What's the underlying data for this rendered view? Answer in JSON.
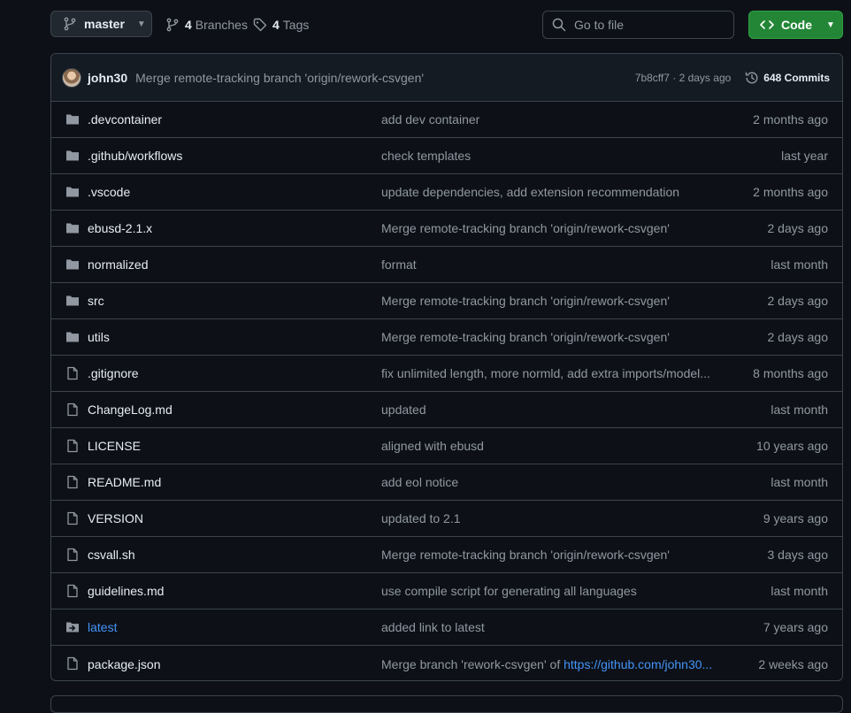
{
  "toolbar": {
    "branch": "master",
    "branches_count": "4",
    "branches_label": "Branches",
    "tags_count": "4",
    "tags_label": "Tags",
    "search_placeholder": "Go to file",
    "code_label": "Code"
  },
  "latest_commit": {
    "author": "john30",
    "message": "Merge remote-tracking branch 'origin/rework-csvgen'",
    "sha_time": "7b8cff7 · 2 days ago",
    "commits_label": "648 Commits"
  },
  "colors": {
    "accent_link": "#4493f8",
    "code_button": "#238636",
    "background": "#0d1117"
  },
  "files": [
    {
      "name": ".devcontainer",
      "type": "folder",
      "icon": "folder-icon",
      "message": "add dev container",
      "age": "2 months ago"
    },
    {
      "name": ".github/workflows",
      "type": "folder",
      "icon": "folder-icon",
      "message": "check templates",
      "age": "last year"
    },
    {
      "name": ".vscode",
      "type": "folder",
      "icon": "folder-icon",
      "message": "update dependencies, add extension recommendation",
      "age": "2 months ago"
    },
    {
      "name": "ebusd-2.1.x",
      "type": "folder",
      "icon": "folder-icon",
      "message": "Merge remote-tracking branch 'origin/rework-csvgen'",
      "age": "2 days ago"
    },
    {
      "name": "normalized",
      "type": "folder",
      "icon": "folder-icon",
      "message": "format",
      "age": "last month"
    },
    {
      "name": "src",
      "type": "folder",
      "icon": "folder-icon",
      "message": "Merge remote-tracking branch 'origin/rework-csvgen'",
      "age": "2 days ago"
    },
    {
      "name": "utils",
      "type": "folder",
      "icon": "folder-icon",
      "message": "Merge remote-tracking branch 'origin/rework-csvgen'",
      "age": "2 days ago"
    },
    {
      "name": ".gitignore",
      "type": "file",
      "icon": "file-icon",
      "message": "fix unlimited length, more normld, add extra imports/model...",
      "age": "8 months ago"
    },
    {
      "name": "ChangeLog.md",
      "type": "file",
      "icon": "file-icon",
      "message": "updated",
      "age": "last month"
    },
    {
      "name": "LICENSE",
      "type": "file",
      "icon": "file-icon",
      "message": "aligned with ebusd",
      "age": "10 years ago"
    },
    {
      "name": "README.md",
      "type": "file",
      "icon": "file-icon",
      "message": "add eol notice",
      "age": "last month"
    },
    {
      "name": "VERSION",
      "type": "file",
      "icon": "file-icon",
      "message": "updated to 2.1",
      "age": "9 years ago"
    },
    {
      "name": "csvall.sh",
      "type": "file",
      "icon": "file-icon",
      "message": "Merge remote-tracking branch 'origin/rework-csvgen'",
      "age": "3 days ago"
    },
    {
      "name": "guidelines.md",
      "type": "file",
      "icon": "file-icon",
      "message": "use compile script for generating all languages",
      "age": "last month"
    },
    {
      "name": "latest",
      "type": "symlink",
      "icon": "symlink-icon",
      "message": "added link to latest",
      "age": "7 years ago"
    },
    {
      "name": "package.json",
      "type": "file",
      "icon": "file-icon",
      "message": "Merge branch 'rework-csvgen' of ",
      "message_link": "https://github.com/john30...",
      "age": "2 weeks ago"
    }
  ]
}
